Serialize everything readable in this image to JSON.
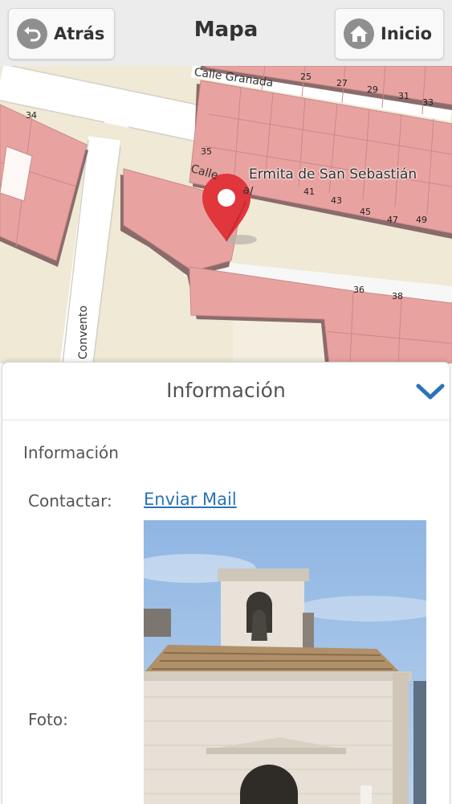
{
  "header": {
    "back_label": "Atrás",
    "title": "Mapa",
    "home_label": "Inicio"
  },
  "map": {
    "poi_label": "Ermita de San Sebastián",
    "street_labels": [
      "Calle Granada",
      "Calle",
      "al",
      "Convento"
    ],
    "house_numbers": [
      "25",
      "27",
      "29",
      "31",
      "33",
      "34",
      "35",
      "41",
      "43",
      "45",
      "47",
      "49",
      "36",
      "38"
    ],
    "colors": {
      "building": "#e8a3a1",
      "building_edge": "#7a5a5a",
      "land": "#efe9d5",
      "road": "#ffffff",
      "marker": "#e0363c"
    }
  },
  "info": {
    "panel_title": "Información",
    "section_label": "Información",
    "contact_label": "Contactar:",
    "contact_link": "Enviar Mail",
    "photo_label": "Foto:",
    "accent": "#2a73b8"
  }
}
